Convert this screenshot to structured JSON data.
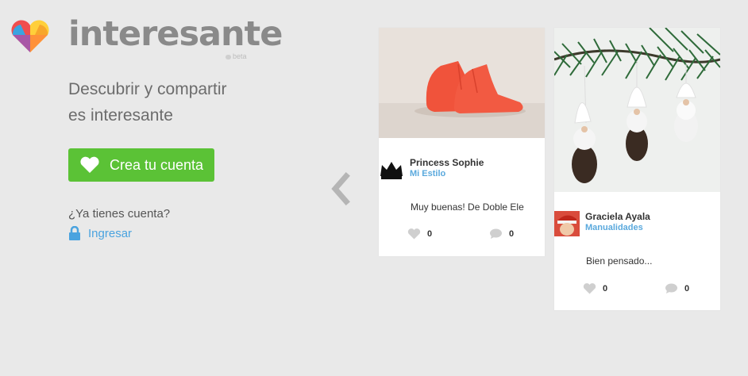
{
  "brand": {
    "name": "interesante",
    "beta": "beta"
  },
  "hero": {
    "tagline_line1": "Descubrir y compartir",
    "tagline_line2": "es interesante",
    "cta_label": "Crea tu cuenta",
    "have_account": "¿Ya tienes cuenta?",
    "login_label": "Ingresar"
  },
  "cards": [
    {
      "image": "red-shoes-photo",
      "author_name": "Princess Sophie",
      "category": "Mi Estilo",
      "comment": "Muy buenas! De Doble Ele",
      "likes": "0",
      "comments": "0"
    },
    {
      "image": "pine-ornaments-photo",
      "author_name": "Graciela Ayala",
      "category": "Manualidades",
      "comment": "Bien pensado...",
      "likes": "0",
      "comments": "0"
    }
  ],
  "colors": {
    "background": "#e9e9e9",
    "brand_gray": "#8a8a8a",
    "cta_green": "#5bc236",
    "link_blue": "#4aa3df",
    "category_blue": "#5aa9dd"
  },
  "icons": [
    "heart-logo-icon",
    "heart-icon",
    "lock-icon",
    "chevron-left-icon",
    "crown-avatar",
    "like-icon",
    "comment-icon"
  ]
}
